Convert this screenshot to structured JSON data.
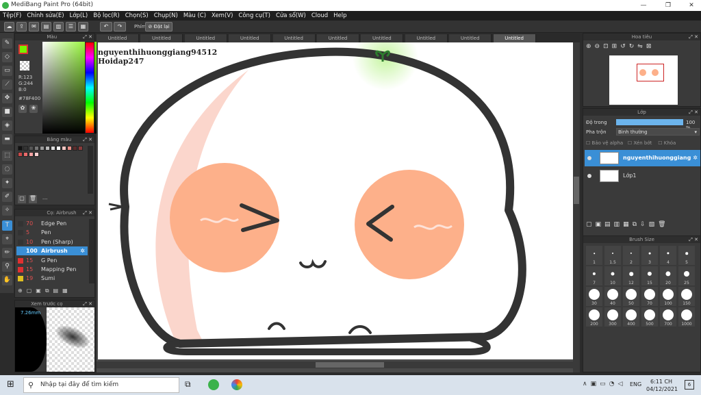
{
  "window": {
    "title": "MediBang Paint Pro (64bit)"
  },
  "menu": [
    "Tệp(F)",
    "Chỉnh sửa(E)",
    "Lớp(L)",
    "Bộ lọc(R)",
    "Chọn(S)",
    "Chụp(N)",
    "Màu (C)",
    "Xem(V)",
    "Công cụ(T)",
    "Cửa sổ(W)",
    "Cloud",
    "Help"
  ],
  "toolbar": {
    "pen_label": "Phím",
    "reset_label": "Đặt lại"
  },
  "color_panel": {
    "title": "Màu",
    "r": "R:123",
    "g": "G:244",
    "b": "B:0",
    "hex": "#78F400",
    "fg_color": "#78f400"
  },
  "palette_panel": {
    "title": "Bảng màu",
    "dash": "---",
    "swatches": [
      "#111111",
      "#333333",
      "#555555",
      "#777777",
      "#999999",
      "#bbbbbb",
      "#dddddd",
      "#ffffff",
      "#f4c7c3",
      "#e88d86",
      "#5a2d2d",
      "#8a3b3b",
      "#c94a4a",
      "#e86a6a",
      "#f5a3a3",
      "#fbd0d0"
    ]
  },
  "brush_panel": {
    "title": "Cọ: Airbrush",
    "items": [
      {
        "size": "70",
        "name": "Edge Pen",
        "color": "#333333"
      },
      {
        "size": "5",
        "name": "Pen",
        "color": "#333333"
      },
      {
        "size": "10",
        "name": "Pen (Sharp)",
        "color": "#333333"
      },
      {
        "size": "100",
        "name": "Airbrush",
        "color": "#3a8fd6"
      },
      {
        "size": "15",
        "name": "G Pen",
        "color": "#e03030"
      },
      {
        "size": "15",
        "name": "Mapping Pen",
        "color": "#e03030"
      },
      {
        "size": "19",
        "name": "Sumi",
        "color": "#e0c020"
      }
    ]
  },
  "preview_panel": {
    "title": "Xem trước cọ",
    "size": "7.26mm"
  },
  "tabs": [
    "Untitled",
    "Untitled",
    "Untitled",
    "Untitled",
    "Untitled",
    "Untitled",
    "Untitled",
    "Untitled",
    "Untitled",
    "Untitled"
  ],
  "canvas": {
    "text_line1": "nguyenthihuonggiang94512",
    "text_line2": "Hoidap247"
  },
  "navigator": {
    "title": "Hoa tiêu"
  },
  "layer_panel": {
    "title": "Lớp",
    "opacity_label": "Độ trong",
    "opacity_value": "100 %",
    "blend_label": "Pha trộn",
    "blend_value": "Bình thường",
    "protect_alpha": "Bảo vệ alpha",
    "clipping": "Xén bớt",
    "lock": "Khóa",
    "layers": [
      {
        "name": "nguyenthihuonggiang"
      },
      {
        "name": "Lớp1"
      }
    ]
  },
  "brush_size_panel": {
    "title": "Brush Size",
    "sizes": [
      "1",
      "1.5",
      "2",
      "3",
      "4",
      "5",
      "7",
      "10",
      "12",
      "15",
      "20",
      "25",
      "30",
      "40",
      "50",
      "70",
      "100",
      "150",
      "200",
      "300",
      "400",
      "500",
      "700",
      "1000"
    ]
  },
  "taskbar": {
    "search_placeholder": "Nhập tại đây để tìm kiếm",
    "time": "6:11 CH",
    "date": "04/12/2021",
    "lang": "ENG",
    "notif_count": "6"
  }
}
